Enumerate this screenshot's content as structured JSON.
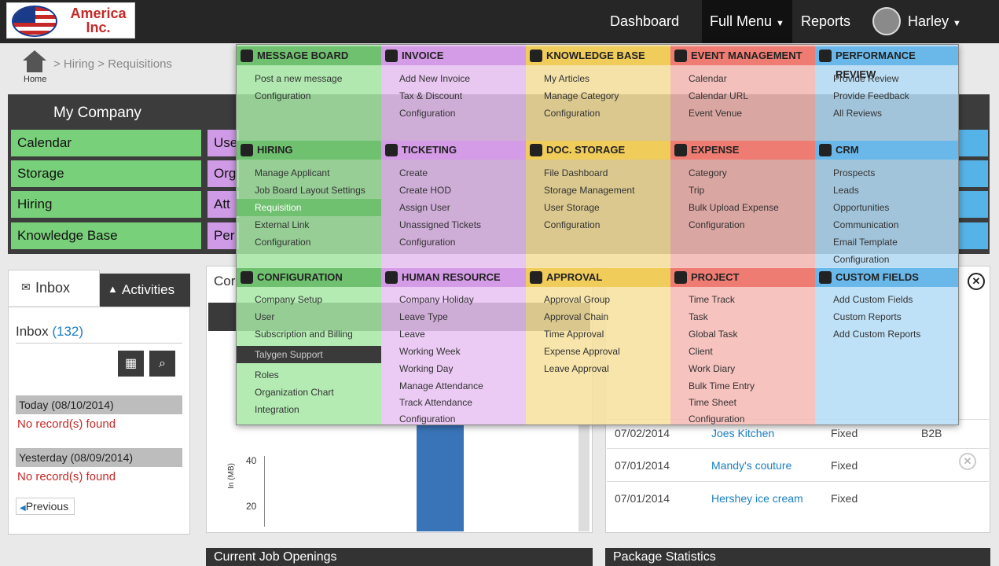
{
  "header": {
    "logo_text": "America Inc.",
    "nav": {
      "dashboard": "Dashboard",
      "full_menu": "Full Menu",
      "reports": "Reports",
      "user": "Harley"
    }
  },
  "breadcrumb": {
    "home": "Home",
    "path": "> Hiring > Requisitions"
  },
  "company": {
    "title": "My Company",
    "tiles_green": [
      "Calendar",
      "Storage",
      "Hiring",
      "Knowledge Base"
    ],
    "tiles_purple": [
      "Use",
      "Org",
      "Att",
      "Per"
    ]
  },
  "inbox": {
    "tab_inbox": "Inbox",
    "tab_activities": "Activities",
    "title": "Inbox",
    "count": "(132)",
    "today": "Today (08/10/2014)",
    "yesterday": "Yesterday (08/09/2014)",
    "no_records": "No record(s) found",
    "previous": "Previous"
  },
  "midpanel": {
    "title": "Cor",
    "bottom_title": "Current Job Openings",
    "y_ticks": [
      "40",
      "20"
    ],
    "y_label": "In (MB)"
  },
  "rightpanel": {
    "bottom_title": "Package Statistics",
    "rows": [
      {
        "date": "07/02/2014",
        "name": "Joes Kitchen",
        "type": "Fixed",
        "extra": "B2B"
      },
      {
        "date": "07/01/2014",
        "name": "Mandy's couture",
        "type": "Fixed",
        "extra": ""
      },
      {
        "date": "07/01/2014",
        "name": "Hershey ice cream",
        "type": "Fixed",
        "extra": ""
      }
    ]
  },
  "menu": {
    "sections": [
      {
        "title": "MESSAGE BOARD",
        "color": "#a6e8a6",
        "items": [
          "Post a new message",
          "Configuration"
        ]
      },
      {
        "title": "INVOICE",
        "color": "#e7c1f2",
        "items": [
          "Add New Invoice",
          "Tax & Discount",
          "Configuration"
        ]
      },
      {
        "title": "KNOWLEDGE BASE",
        "color": "#f6e19c",
        "items": [
          "My Articles",
          "Manage Category",
          "Configuration"
        ]
      },
      {
        "title": "EVENT MANAGEMENT",
        "color": "#f6b8b4",
        "items": [
          "Calendar",
          "Calendar URL",
          "Event Venue"
        ]
      },
      {
        "title": "PERFORMANCE REVIEW",
        "color": "#b4dcf6",
        "items": [
          "Provide Review",
          "Provide Feedback",
          "All Reviews"
        ]
      },
      {
        "title": "HIRING",
        "color": "#a6e8a6",
        "items": [
          "Manage Applicant",
          "Job Board Layout Settings",
          "Requisition",
          "External Link",
          "Configuration"
        ]
      },
      {
        "title": "TICKETING",
        "color": "#e7c1f2",
        "items": [
          "Create",
          "Create HOD",
          "Assign User",
          "Unassigned Tickets",
          "Configuration"
        ]
      },
      {
        "title": "DOC. STORAGE",
        "color": "#f6e19c",
        "items": [
          "File Dashboard",
          "Storage Management",
          "User Storage",
          "Configuration"
        ]
      },
      {
        "title": "EXPENSE",
        "color": "#f6b8b4",
        "items": [
          "Category",
          "Trip",
          "Bulk Upload Expense",
          "Configuration"
        ]
      },
      {
        "title": "CRM",
        "color": "#b4dcf6",
        "items": [
          "Prospects",
          "Leads",
          "Opportunities",
          "Communication",
          "Email Template",
          "Configuration"
        ]
      },
      {
        "title": "CONFIGURATION",
        "color": "#a6e8a6",
        "items": [
          "Company Setup",
          "User",
          "Subscription and Billing",
          "Talygen Support",
          "Roles",
          "Organization Chart",
          "Integration"
        ]
      },
      {
        "title": "HUMAN RESOURCE",
        "color": "#e7c1f2",
        "items": [
          "Company Holiday",
          "Leave Type",
          "Leave",
          "Working Week",
          "Working Day",
          "Manage Attendance",
          "Track Attendance",
          "Configuration"
        ]
      },
      {
        "title": "APPROVAL",
        "color": "#f6e19c",
        "items": [
          "Approval Group",
          "Approval Chain",
          "Time Approval",
          "Expense Approval",
          "Leave Approval"
        ]
      },
      {
        "title": "PROJECT",
        "color": "#f6b8b4",
        "items": [
          "Time Track",
          "Task",
          "Global Task",
          "Client",
          "Work Diary",
          "Bulk Time Entry",
          "Time Sheet",
          "Configuration"
        ]
      },
      {
        "title": "CUSTOM FIELDS",
        "color": "#b4dcf6",
        "items": [
          "Add Custom Fields",
          "Custom Reports",
          "Add Custom Reports"
        ]
      }
    ]
  },
  "icons": [
    "home-icon",
    "calendar-icon",
    "search-icon",
    "envelope-icon",
    "bell-icon",
    "close-icon"
  ]
}
